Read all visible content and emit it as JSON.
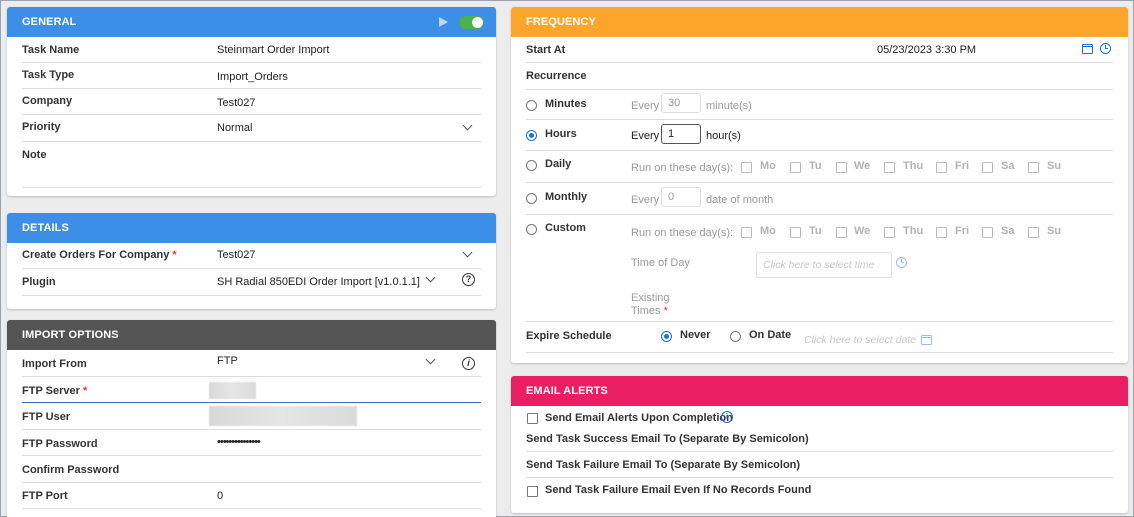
{
  "general": {
    "header": "GENERAL",
    "fields": [
      {
        "label": "Task Name",
        "value": "Steinmart Order Import"
      },
      {
        "label": "Task Type",
        "value": "Import_Orders"
      },
      {
        "label": "Company",
        "value": "Test027"
      },
      {
        "label": "Priority",
        "value": "Normal"
      },
      {
        "label": "Note",
        "value": ""
      }
    ],
    "toggle_on": true
  },
  "details": {
    "header": "DETAILS",
    "company_label": "Create Orders For Company",
    "company_value": "Test027",
    "plugin_label": "Plugin",
    "plugin_value": "SH Radial 850EDI Order Import [v1.0.1.1]",
    "help_icon": "?"
  },
  "import_options": {
    "header": "IMPORT OPTIONS",
    "import_from_label": "Import From",
    "import_from_value": "FTP",
    "info_icon": "i",
    "ftp_server_label": "FTP Server",
    "ftp_user_label": "FTP User",
    "ftp_password_label": "FTP Password",
    "ftp_password_value": "•••••••••••••••",
    "confirm_password_label": "Confirm Password",
    "ftp_port_label": "FTP Port",
    "ftp_port_value": "0",
    "required_mark": "*"
  },
  "frequency": {
    "header": "FREQUENCY",
    "start_at_label": "Start At",
    "start_at_value": "05/23/2023 3:30 PM",
    "recurrence_label": "Recurrence",
    "minutes": {
      "label": "Minutes",
      "every": "Every",
      "value": "30",
      "unit": "minute(s)"
    },
    "hours": {
      "label": "Hours",
      "every": "Every",
      "value": "1",
      "unit": "hour(s)"
    },
    "daily": {
      "label": "Daily",
      "run_on": "Run on these day(s):"
    },
    "monthly": {
      "label": "Monthly",
      "every": "Every",
      "value": "0",
      "unit": "date of month"
    },
    "custom": {
      "label": "Custom",
      "run_on": "Run on these day(s):",
      "time_of_day": "Time of Day",
      "time_placeholder": "Click here to select time",
      "existing_times": "Existing",
      "existing_times2": "Times"
    },
    "days": [
      "Mo",
      "Tu",
      "We",
      "Thu",
      "Fri",
      "Sa",
      "Su"
    ],
    "expire_label": "Expire Schedule",
    "never_label": "Never",
    "on_date_label": "On Date",
    "date_placeholder": "Click here to select date"
  },
  "email_alerts": {
    "header": "EMAIL ALERTS",
    "send_upon_completion": "Send Email Alerts Upon Completion",
    "success_label": "Send Task Success Email To (Separate By Semicolon)",
    "failure_label": "Send Task Failure Email To (Separate By Semicolon)",
    "failure_no_records": "Send Task Failure Email Even If No Records Found"
  },
  "colors": {
    "general": "#3d8ee6",
    "details": "#3d8ee6",
    "import_options": "#545454",
    "frequency": "#fba52a",
    "email_alerts": "#e91e63",
    "toggle": "#4caf50",
    "accent": "#1e6fd9"
  }
}
